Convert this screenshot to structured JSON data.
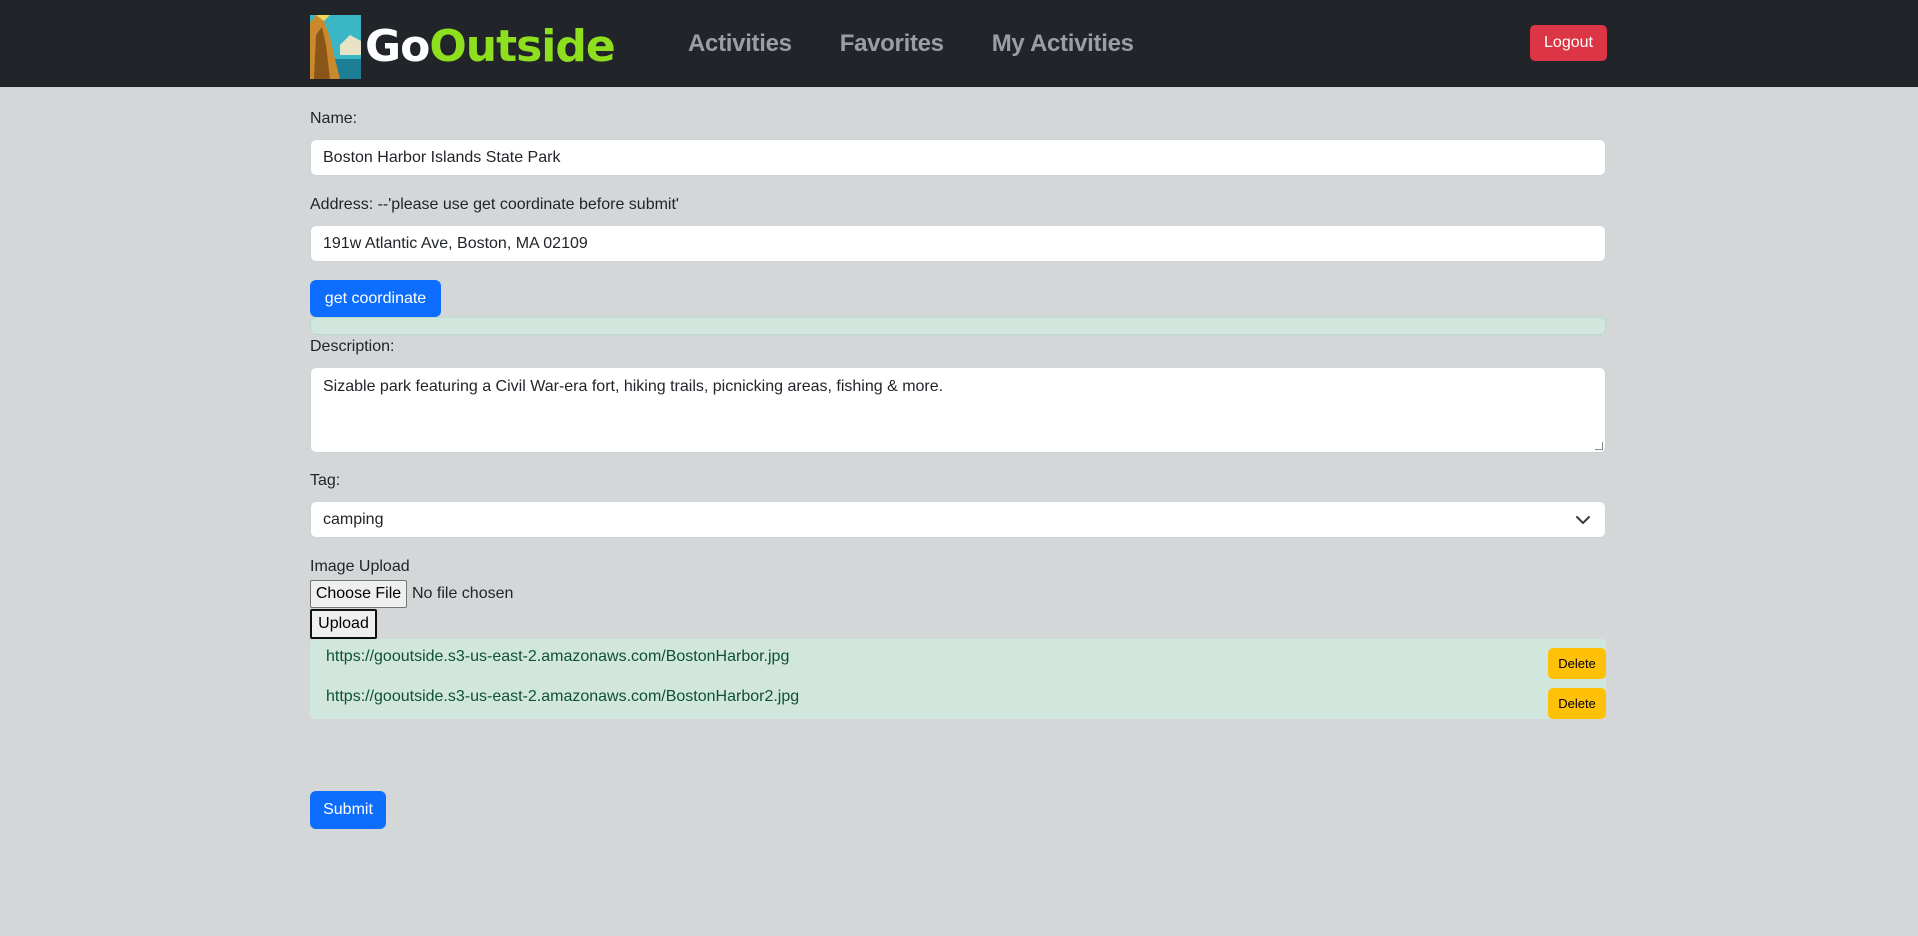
{
  "nav": {
    "logo_go": "Go",
    "logo_outside": "Outside",
    "links": [
      "Activities",
      "Favorites",
      "My Activities"
    ],
    "logout_label": "Logout"
  },
  "form": {
    "name_label": "Name:",
    "name_value": "Boston Harbor Islands State Park",
    "address_label": "Address: --'please use get coordinate before submit'",
    "address_value": "191w Atlantic Ave, Boston, MA 02109",
    "get_coordinate_label": "get coordinate",
    "description_label": "Description:",
    "description_value": "Sizable park featuring a Civil War-era fort, hiking trails, picnicking areas, fishing & more.",
    "tag_label": "Tag:",
    "tag_value": "camping",
    "image_upload_label": "Image Upload",
    "choose_file_label": "Choose File",
    "file_status": "No file chosen",
    "upload_label": "Upload",
    "images": [
      {
        "url": "https://gooutside.s3-us-east-2.amazonaws.com/BostonHarbor.jpg",
        "delete_label": "Delete"
      },
      {
        "url": "https://gooutside.s3-us-east-2.amazonaws.com/BostonHarbor2.jpg",
        "delete_label": "Delete"
      }
    ],
    "submit_label": "Submit"
  },
  "colors": {
    "navbar": "#212529",
    "page_bg": "#d3d7d8",
    "primary": "#0d6efd",
    "danger": "#dc3545",
    "warning": "#ffc107",
    "success_bg": "#d1e7dd",
    "logo_green": "#8ee01f"
  }
}
